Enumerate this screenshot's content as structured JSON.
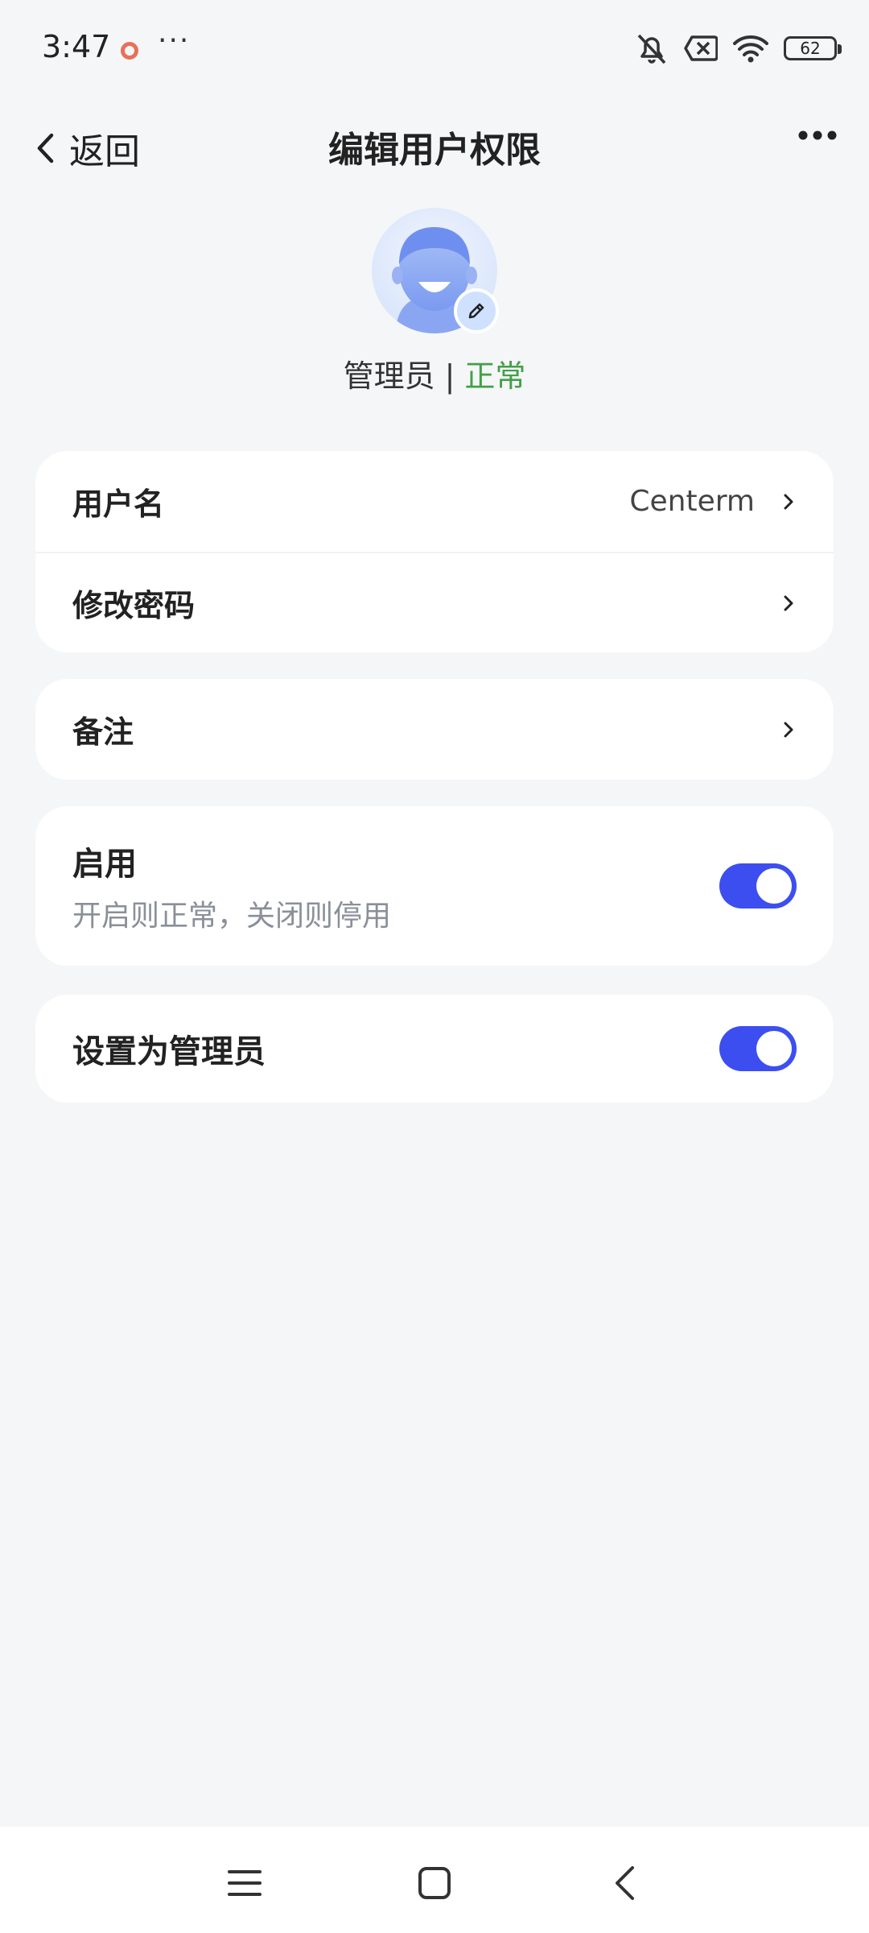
{
  "status_bar": {
    "time": "3:47",
    "dots": "···",
    "battery_level": "62",
    "icons": [
      "recording-icon",
      "mute-icon",
      "no-sim-icon",
      "wifi-icon",
      "battery-icon"
    ]
  },
  "header": {
    "back_label": "返回",
    "title": "编辑用户权限"
  },
  "profile": {
    "role": "管理员",
    "separator": "|",
    "status": "正常",
    "status_color": "#43a047"
  },
  "card1": {
    "username_label": "用户名",
    "username_value": "Centerm",
    "password_label": "修改密码"
  },
  "card2": {
    "remark_label": "备注"
  },
  "card3": {
    "enable_label": "启用",
    "enable_sub": "开启则正常，关闭则停用",
    "enable_on": true
  },
  "card4": {
    "admin_label": "设置为管理员",
    "admin_on": true
  },
  "colors": {
    "accent": "#3d4ef0",
    "background": "#f5f6f8"
  }
}
